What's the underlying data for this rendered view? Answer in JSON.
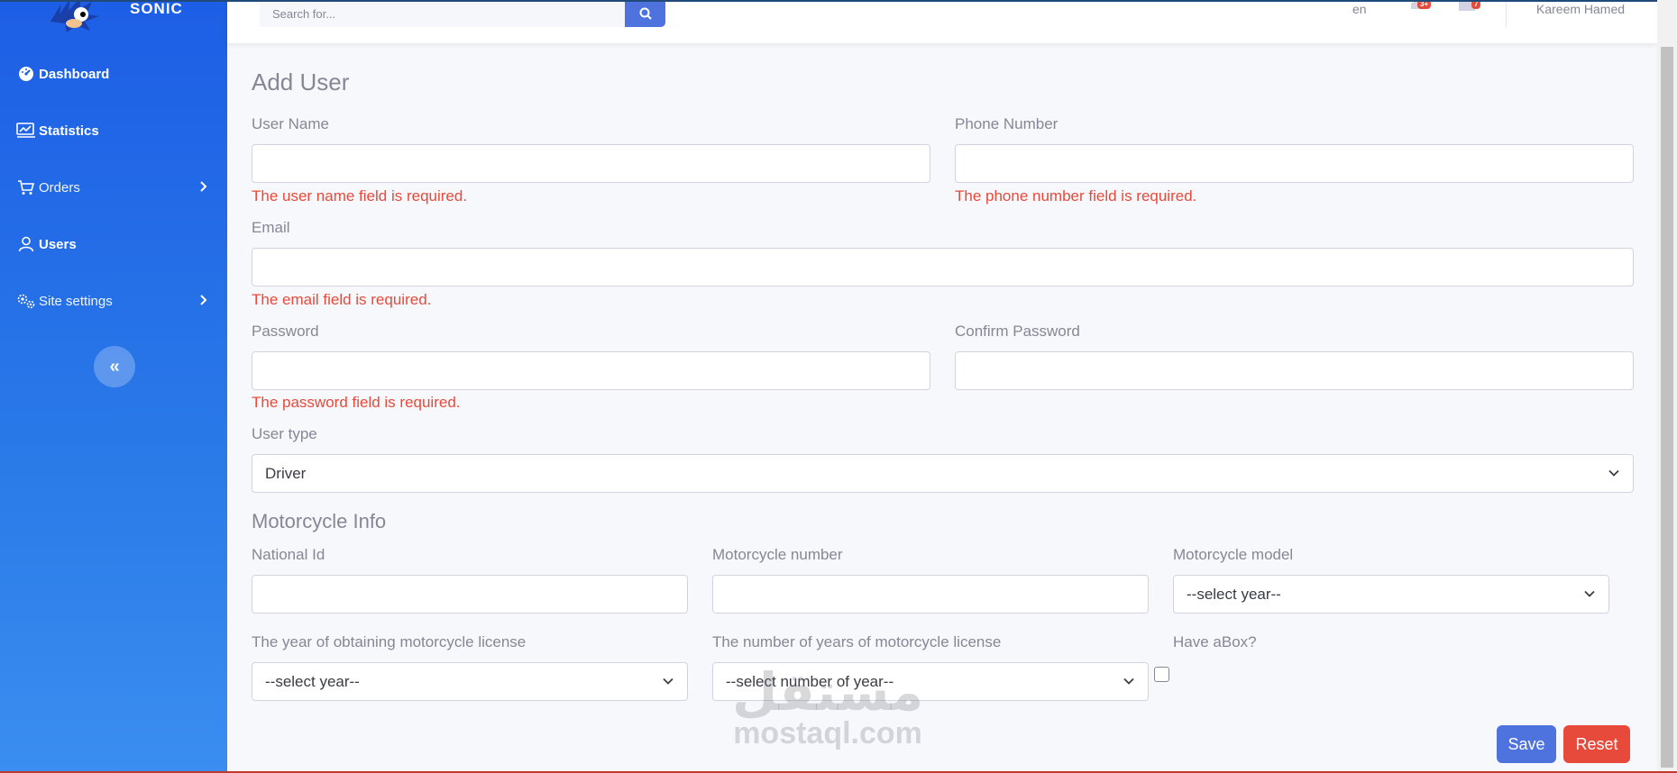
{
  "brand": {
    "name": "SONIC"
  },
  "sidebar": {
    "items": [
      {
        "label": "Dashboard",
        "icon": "dashboard-icon"
      },
      {
        "label": "Statistics",
        "icon": "chart-icon"
      },
      {
        "label": "Orders",
        "icon": "cart-icon",
        "has_submenu": true
      },
      {
        "label": "Users",
        "icon": "user-icon"
      },
      {
        "label": "Site settings",
        "icon": "gears-icon",
        "has_submenu": true
      }
    ],
    "collapse_label": "«"
  },
  "topbar": {
    "search_placeholder": "Search for...",
    "language": "en",
    "notifications_badge": "3+",
    "messages_badge": "7",
    "user_name": "Kareem Hamed"
  },
  "form": {
    "title": "Add User",
    "user_name_label": "User Name",
    "user_name_error": "The user name field is required.",
    "phone_label": "Phone Number",
    "phone_error": "The phone number field is required.",
    "email_label": "Email",
    "email_error": "The email field is required.",
    "password_label": "Password",
    "password_error": "The password field is required.",
    "confirm_password_label": "Confirm Password",
    "user_type_label": "User type",
    "user_type_value": "Driver"
  },
  "motorcycle": {
    "section_title": "Motorcycle Info",
    "national_id_label": "National Id",
    "number_label": "Motorcycle number",
    "model_label": "Motorcycle model",
    "model_value": "--select year--",
    "license_year_label": "The year of obtaining motorcycle license",
    "license_year_value": "--select year--",
    "license_years_label": "The number of years of motorcycle license",
    "license_years_value": "--select number of year--",
    "have_box_label": "Have aBox?"
  },
  "actions": {
    "save": "Save",
    "reset": "Reset"
  },
  "watermark": {
    "arabic": "مستقل",
    "latin": "mostaql.com"
  },
  "colors": {
    "primary": "#4e73df",
    "danger": "#e74a3b",
    "sidebar": "#1d5ee6"
  }
}
